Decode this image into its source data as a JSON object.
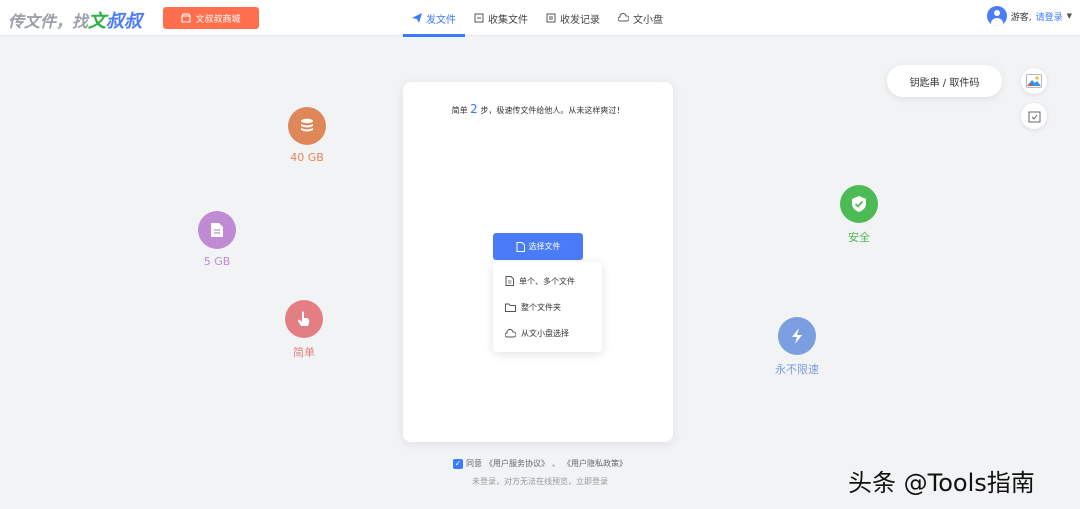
{
  "header": {
    "logo_prefix": "传文件，找",
    "logo_wen": "文",
    "logo_shushu": "叔叔",
    "shop_button": "文叔叔商城",
    "nav": [
      {
        "label": "发文件",
        "icon": "send-icon",
        "active": true
      },
      {
        "label": "收集文件",
        "icon": "collect-icon",
        "active": false
      },
      {
        "label": "收发记录",
        "icon": "record-icon",
        "active": false
      },
      {
        "label": "文小盘",
        "icon": "cloud-icon",
        "active": false
      }
    ],
    "user_label": "游客,",
    "login_link": "请登录"
  },
  "features": {
    "storage_40": "40 GB",
    "storage_5": "5 GB",
    "simple": "简单",
    "secure": "安全",
    "speed": "永不限速"
  },
  "colors": {
    "accent": "#3a7afe",
    "storage_40": "#e0875a",
    "storage_5": "#c08ad4",
    "simple": "#e37f83",
    "secure": "#4dbb55",
    "speed": "#7a9ee0"
  },
  "right_panel": {
    "key_button": "钥匙串 / 取件码"
  },
  "card": {
    "tagline_pre": "简单 ",
    "tagline_num": "2",
    "tagline_post": " 步，极速传文件给他人。从未这样爽过！",
    "select_button": "选择文件",
    "menu": [
      {
        "label": "单个、多个文件",
        "icon": "file-icon"
      },
      {
        "label": "整个文件夹",
        "icon": "folder-icon"
      },
      {
        "label": "从文小盘选择",
        "icon": "cloud-icon"
      }
    ]
  },
  "footer": {
    "agree_prefix": "同意",
    "terms": "《用户服务协议》",
    "separator": "、",
    "privacy": "《用户隐私政策》",
    "note": "未登录，对方无法在线预览，立即登录"
  },
  "watermark": "头条 @Tools指南"
}
